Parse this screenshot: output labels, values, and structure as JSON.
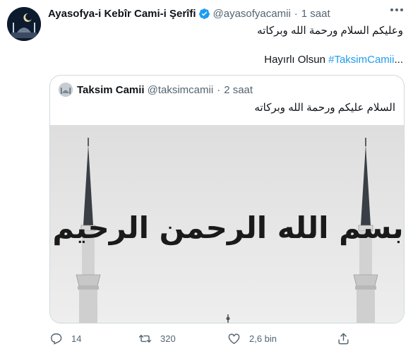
{
  "tweet": {
    "author_name": "Ayasofya-i Kebîr Cami-i Şerîfi",
    "handle": "@ayasofyacamii",
    "separator": "·",
    "time": "1 saat",
    "text_arabic": "وعليكم السلام ورحمة الله وبركاته",
    "text_turkish": "Hayırlı Olsun",
    "hashtag": "#TaksimCamii",
    "text_trailing": "...",
    "accent_color": "#1d9bf0"
  },
  "quoted": {
    "author_name": "Taksim Camii",
    "handle": "@taksimcamii",
    "separator": "·",
    "time": "2 saat",
    "text_arabic": "السلام عليكم ورحمة الله وبركاته",
    "image_calligraphy": "بسم الله الرحمن الرحيم"
  },
  "actions": {
    "reply_count": "14",
    "retweet_count": "320",
    "like_count": "2,6 bin",
    "icons": [
      "reply-icon",
      "retweet-icon",
      "like-icon",
      "share-icon"
    ]
  }
}
